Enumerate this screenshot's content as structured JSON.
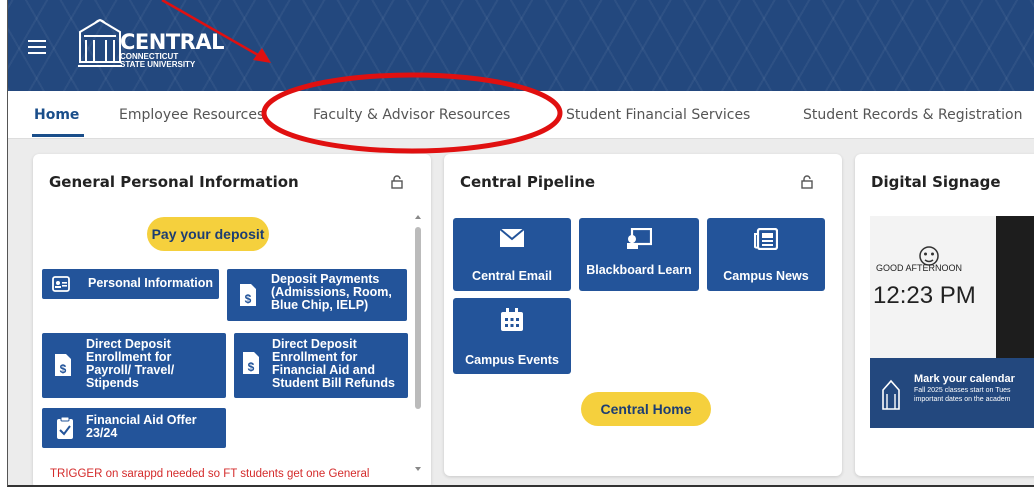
{
  "header": {
    "logo": {
      "line1": "CENTRAL",
      "line2": "CONNECTICUT",
      "line3": "STATE UNIVERSITY"
    },
    "menu_icon": "hamburger-icon"
  },
  "tabs": [
    {
      "label": "Home",
      "active": true
    },
    {
      "label": "Employee Resources"
    },
    {
      "label": "Faculty & Advisor Resources"
    },
    {
      "label": "Student Financial Services"
    },
    {
      "label": "Student Records & Registration"
    }
  ],
  "cards": {
    "personal": {
      "title": "General Personal Information",
      "pay_deposit": "Pay your deposit",
      "buttons": [
        {
          "label": "Personal Information",
          "icon": "id-card-icon"
        },
        {
          "label": "Deposit Payments (Admissions, Room, Blue Chip, IELP)",
          "icon": "dollar-document-icon"
        },
        {
          "label": "Direct Deposit Enrollment for Payroll/ Travel/ Stipends",
          "icon": "dollar-document-icon"
        },
        {
          "label": "Direct Deposit Enrollment for Financial Aid and Student Bill Refunds",
          "icon": "dollar-document-icon"
        },
        {
          "label": "Financial Aid Offer 23/24",
          "icon": "clipboard-check-icon"
        }
      ],
      "trigger_text": "TRIGGER on sarappd needed so FT students get one General"
    },
    "pipeline": {
      "title": "Central Pipeline",
      "tiles": [
        {
          "label": "Central Email",
          "icon": "envelope-icon"
        },
        {
          "label": "Blackboard Learn",
          "icon": "presentation-icon"
        },
        {
          "label": "Campus News",
          "icon": "newspaper-icon"
        },
        {
          "label": "Campus Events",
          "icon": "calendar-icon"
        }
      ],
      "home_button": "Central Home"
    },
    "signage": {
      "title": "Digital Signage",
      "greeting": "GOOD AFTERNOON",
      "time": "12:23 PM",
      "headline": "Mark your calendar",
      "sub1": "Fall 2025 classes start on Tues",
      "sub2": "important dates on the academ"
    }
  },
  "colors": {
    "brand_blue": "#23487e",
    "button_blue": "#23549a",
    "accent_yellow": "#f5d03d",
    "annotation_red": "#e01010"
  }
}
